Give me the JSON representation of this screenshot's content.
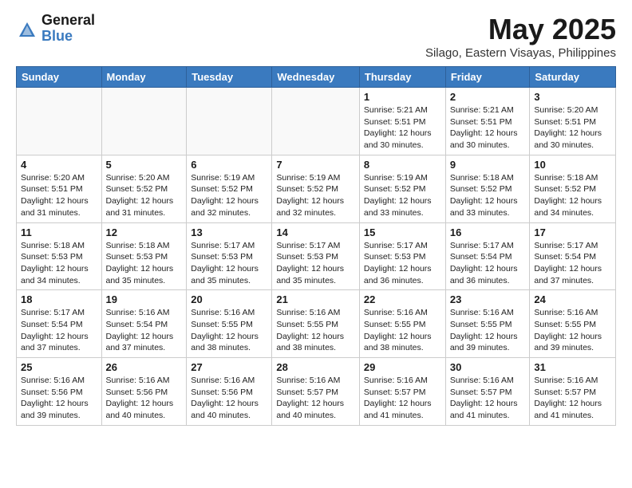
{
  "logo": {
    "general": "General",
    "blue": "Blue"
  },
  "title": {
    "month_year": "May 2025",
    "location": "Silago, Eastern Visayas, Philippines"
  },
  "weekdays": [
    "Sunday",
    "Monday",
    "Tuesday",
    "Wednesday",
    "Thursday",
    "Friday",
    "Saturday"
  ],
  "weeks": [
    [
      {
        "day": "",
        "info": ""
      },
      {
        "day": "",
        "info": ""
      },
      {
        "day": "",
        "info": ""
      },
      {
        "day": "",
        "info": ""
      },
      {
        "day": "1",
        "info": "Sunrise: 5:21 AM\nSunset: 5:51 PM\nDaylight: 12 hours\nand 30 minutes."
      },
      {
        "day": "2",
        "info": "Sunrise: 5:21 AM\nSunset: 5:51 PM\nDaylight: 12 hours\nand 30 minutes."
      },
      {
        "day": "3",
        "info": "Sunrise: 5:20 AM\nSunset: 5:51 PM\nDaylight: 12 hours\nand 30 minutes."
      }
    ],
    [
      {
        "day": "4",
        "info": "Sunrise: 5:20 AM\nSunset: 5:51 PM\nDaylight: 12 hours\nand 31 minutes."
      },
      {
        "day": "5",
        "info": "Sunrise: 5:20 AM\nSunset: 5:52 PM\nDaylight: 12 hours\nand 31 minutes."
      },
      {
        "day": "6",
        "info": "Sunrise: 5:19 AM\nSunset: 5:52 PM\nDaylight: 12 hours\nand 32 minutes."
      },
      {
        "day": "7",
        "info": "Sunrise: 5:19 AM\nSunset: 5:52 PM\nDaylight: 12 hours\nand 32 minutes."
      },
      {
        "day": "8",
        "info": "Sunrise: 5:19 AM\nSunset: 5:52 PM\nDaylight: 12 hours\nand 33 minutes."
      },
      {
        "day": "9",
        "info": "Sunrise: 5:18 AM\nSunset: 5:52 PM\nDaylight: 12 hours\nand 33 minutes."
      },
      {
        "day": "10",
        "info": "Sunrise: 5:18 AM\nSunset: 5:52 PM\nDaylight: 12 hours\nand 34 minutes."
      }
    ],
    [
      {
        "day": "11",
        "info": "Sunrise: 5:18 AM\nSunset: 5:53 PM\nDaylight: 12 hours\nand 34 minutes."
      },
      {
        "day": "12",
        "info": "Sunrise: 5:18 AM\nSunset: 5:53 PM\nDaylight: 12 hours\nand 35 minutes."
      },
      {
        "day": "13",
        "info": "Sunrise: 5:17 AM\nSunset: 5:53 PM\nDaylight: 12 hours\nand 35 minutes."
      },
      {
        "day": "14",
        "info": "Sunrise: 5:17 AM\nSunset: 5:53 PM\nDaylight: 12 hours\nand 35 minutes."
      },
      {
        "day": "15",
        "info": "Sunrise: 5:17 AM\nSunset: 5:53 PM\nDaylight: 12 hours\nand 36 minutes."
      },
      {
        "day": "16",
        "info": "Sunrise: 5:17 AM\nSunset: 5:54 PM\nDaylight: 12 hours\nand 36 minutes."
      },
      {
        "day": "17",
        "info": "Sunrise: 5:17 AM\nSunset: 5:54 PM\nDaylight: 12 hours\nand 37 minutes."
      }
    ],
    [
      {
        "day": "18",
        "info": "Sunrise: 5:17 AM\nSunset: 5:54 PM\nDaylight: 12 hours\nand 37 minutes."
      },
      {
        "day": "19",
        "info": "Sunrise: 5:16 AM\nSunset: 5:54 PM\nDaylight: 12 hours\nand 37 minutes."
      },
      {
        "day": "20",
        "info": "Sunrise: 5:16 AM\nSunset: 5:55 PM\nDaylight: 12 hours\nand 38 minutes."
      },
      {
        "day": "21",
        "info": "Sunrise: 5:16 AM\nSunset: 5:55 PM\nDaylight: 12 hours\nand 38 minutes."
      },
      {
        "day": "22",
        "info": "Sunrise: 5:16 AM\nSunset: 5:55 PM\nDaylight: 12 hours\nand 38 minutes."
      },
      {
        "day": "23",
        "info": "Sunrise: 5:16 AM\nSunset: 5:55 PM\nDaylight: 12 hours\nand 39 minutes."
      },
      {
        "day": "24",
        "info": "Sunrise: 5:16 AM\nSunset: 5:55 PM\nDaylight: 12 hours\nand 39 minutes."
      }
    ],
    [
      {
        "day": "25",
        "info": "Sunrise: 5:16 AM\nSunset: 5:56 PM\nDaylight: 12 hours\nand 39 minutes."
      },
      {
        "day": "26",
        "info": "Sunrise: 5:16 AM\nSunset: 5:56 PM\nDaylight: 12 hours\nand 40 minutes."
      },
      {
        "day": "27",
        "info": "Sunrise: 5:16 AM\nSunset: 5:56 PM\nDaylight: 12 hours\nand 40 minutes."
      },
      {
        "day": "28",
        "info": "Sunrise: 5:16 AM\nSunset: 5:57 PM\nDaylight: 12 hours\nand 40 minutes."
      },
      {
        "day": "29",
        "info": "Sunrise: 5:16 AM\nSunset: 5:57 PM\nDaylight: 12 hours\nand 41 minutes."
      },
      {
        "day": "30",
        "info": "Sunrise: 5:16 AM\nSunset: 5:57 PM\nDaylight: 12 hours\nand 41 minutes."
      },
      {
        "day": "31",
        "info": "Sunrise: 5:16 AM\nSunset: 5:57 PM\nDaylight: 12 hours\nand 41 minutes."
      }
    ]
  ]
}
